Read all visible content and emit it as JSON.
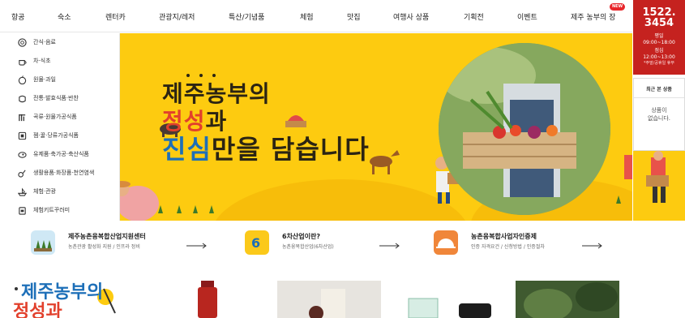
{
  "nav": {
    "items": [
      "항공",
      "숙소",
      "렌터카",
      "관광지/레저",
      "특산/기념품",
      "체험",
      "맛집",
      "여행사 상품",
      "기획전",
      "이벤트",
      "제주 농부의 장"
    ],
    "new_badge": "NEW"
  },
  "phone": {
    "number_line1": "1522.",
    "number_line2": "3454",
    "weekday_label": "평일",
    "weekday_hours": "09:00~18:00",
    "lunch_label": "점심",
    "lunch_hours": "12:00~13:00",
    "note": "*주말/공휴일 휴무"
  },
  "categories": [
    {
      "label": "간식·음료",
      "icon": "donut-icon"
    },
    {
      "label": "차·식초",
      "icon": "teapot-icon"
    },
    {
      "label": "원물·과일",
      "icon": "fruit-icon"
    },
    {
      "label": "전통·발효식품·반찬",
      "icon": "jar-icon"
    },
    {
      "label": "곡류·원물가공식품",
      "icon": "grain-icon"
    },
    {
      "label": "젬·꿀·당류가공식품",
      "icon": "honey-icon"
    },
    {
      "label": "유제품·축가공·축산식품",
      "icon": "meat-icon"
    },
    {
      "label": "생활용품·화장품·천연염색",
      "icon": "cosmetic-icon"
    },
    {
      "label": "체험·관광",
      "icon": "boat-icon"
    },
    {
      "label": "체험키트꾸러미",
      "icon": "kit-icon"
    }
  ],
  "hero": {
    "line1": "제주농부의",
    "line2_red": "정성",
    "line2_rest": "과",
    "line3_blue": "진심",
    "line3_rest": "만을 ",
    "line3_bold": "담습니다"
  },
  "recent": {
    "title": "최근 본 상품",
    "empty_line1": "상품이",
    "empty_line2": "없습니다."
  },
  "info": [
    {
      "title": "제주농촌융복합산업지원센터",
      "sub": "농촌관광 활성화 지원 / 인프라 정비",
      "icon": "plants-icon",
      "color": "#cfe8f5"
    },
    {
      "title": "6차산업이란?",
      "sub": "농촌융복합산업(6차산업)",
      "icon": "six-icon",
      "color": "#fbc91a"
    },
    {
      "title": "농촌융복합사업자인증제",
      "sub": "인증 자격요건 / 신청방법 / 인증절차",
      "icon": "sunrise-icon",
      "color": "#f0863a"
    }
  ],
  "promo": {
    "line1": "제주농부의",
    "line2": "정성과"
  },
  "colors": {
    "hero_bg": "#fdcb10",
    "accent_red": "#c5221f",
    "hero_red": "#e2402c",
    "hero_blue": "#1d6fb8"
  }
}
